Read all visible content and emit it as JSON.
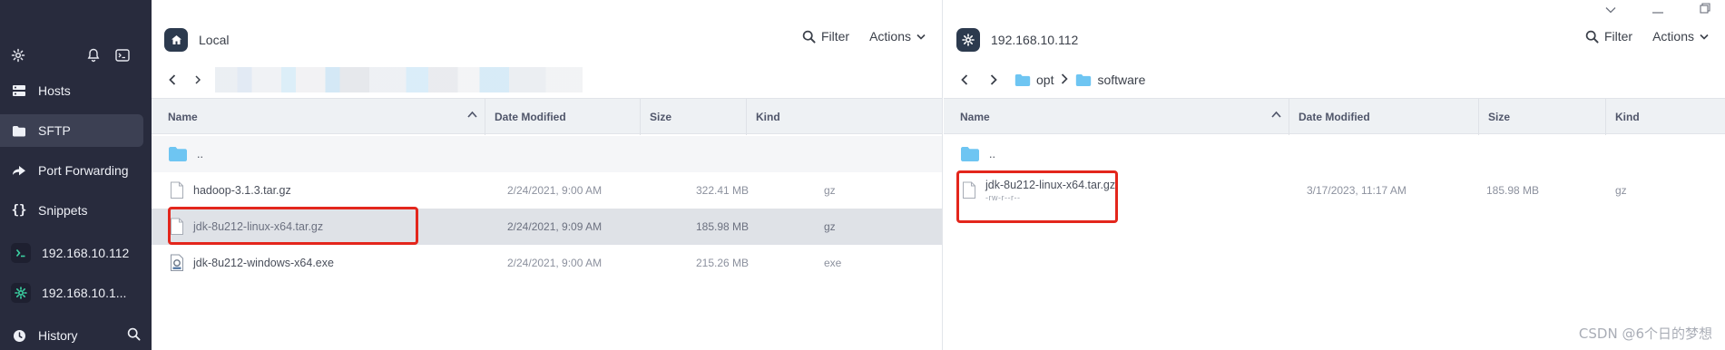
{
  "sidebar": {
    "items": [
      {
        "label": "Hosts"
      },
      {
        "label": "SFTP"
      },
      {
        "label": "Port Forwarding"
      },
      {
        "label": "Snippets"
      },
      {
        "label": "192.168.10.112"
      },
      {
        "label": "192.168.10.1..."
      },
      {
        "label": "History"
      }
    ]
  },
  "left_panel": {
    "title": "Local",
    "filter_label": "Filter",
    "actions_label": "Actions",
    "columns": [
      "Name",
      "Date Modified",
      "Size",
      "Kind"
    ],
    "parent_label": "..",
    "rows": [
      {
        "name": "hadoop-3.1.3.tar.gz",
        "date": "2/24/2021, 9:00 AM",
        "size": "322.41 MB",
        "kind": "gz"
      },
      {
        "name": "jdk-8u212-linux-x64.tar.gz",
        "date": "2/24/2021, 9:09 AM",
        "size": "185.98 MB",
        "kind": "gz"
      },
      {
        "name": "jdk-8u212-windows-x64.exe",
        "date": "2/24/2021, 9:00 AM",
        "size": "215.26 MB",
        "kind": "exe"
      }
    ]
  },
  "right_panel": {
    "title": "192.168.10.112",
    "filter_label": "Filter",
    "actions_label": "Actions",
    "path": [
      "opt",
      "software"
    ],
    "columns": [
      "Name",
      "Date Modified",
      "Size",
      "Kind"
    ],
    "parent_label": "..",
    "rows": [
      {
        "name": "jdk-8u212-linux-x64.tar.gz",
        "perm": "-rw-r--r--",
        "date": "3/17/2023, 11:17 AM",
        "size": "185.98 MB",
        "kind": "gz"
      }
    ]
  },
  "watermark": "CSDN @6个日的梦想",
  "colors": {
    "sidebar_bg": "#282b3d",
    "highlight": "#e3261c",
    "folder": "#6ec5f2"
  }
}
